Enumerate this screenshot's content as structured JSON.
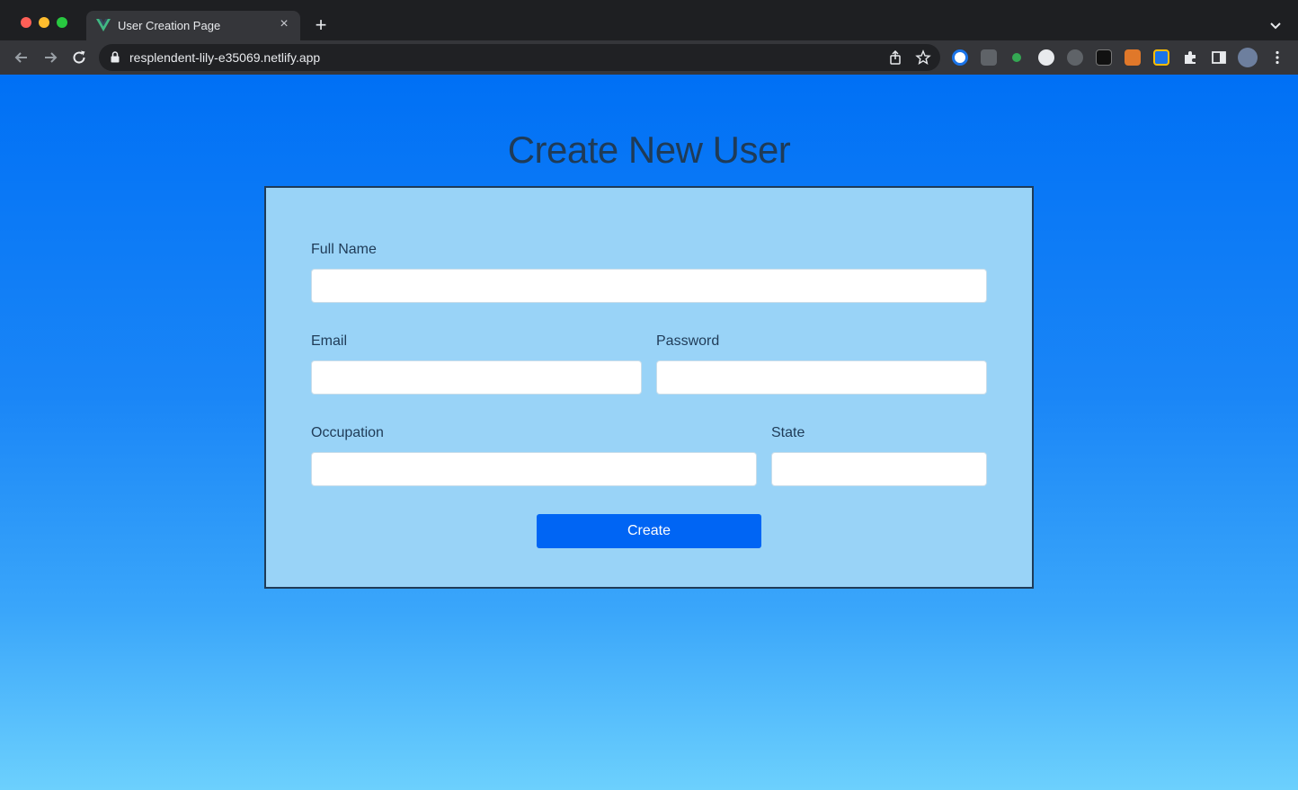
{
  "browser": {
    "tab_title": "User Creation Page",
    "tab_close": "×",
    "new_tab": "+",
    "url": "resplendent-lily-e35069.netlify.app"
  },
  "page": {
    "title": "Create New User"
  },
  "form": {
    "full_name_label": "Full Name",
    "email_label": "Email",
    "password_label": "Password",
    "occupation_label": "Occupation",
    "state_label": "State",
    "create_label": "Create"
  },
  "colors": {
    "accent": "#0065f4",
    "card": "#99d3f7",
    "heading": "#1f3b57"
  }
}
